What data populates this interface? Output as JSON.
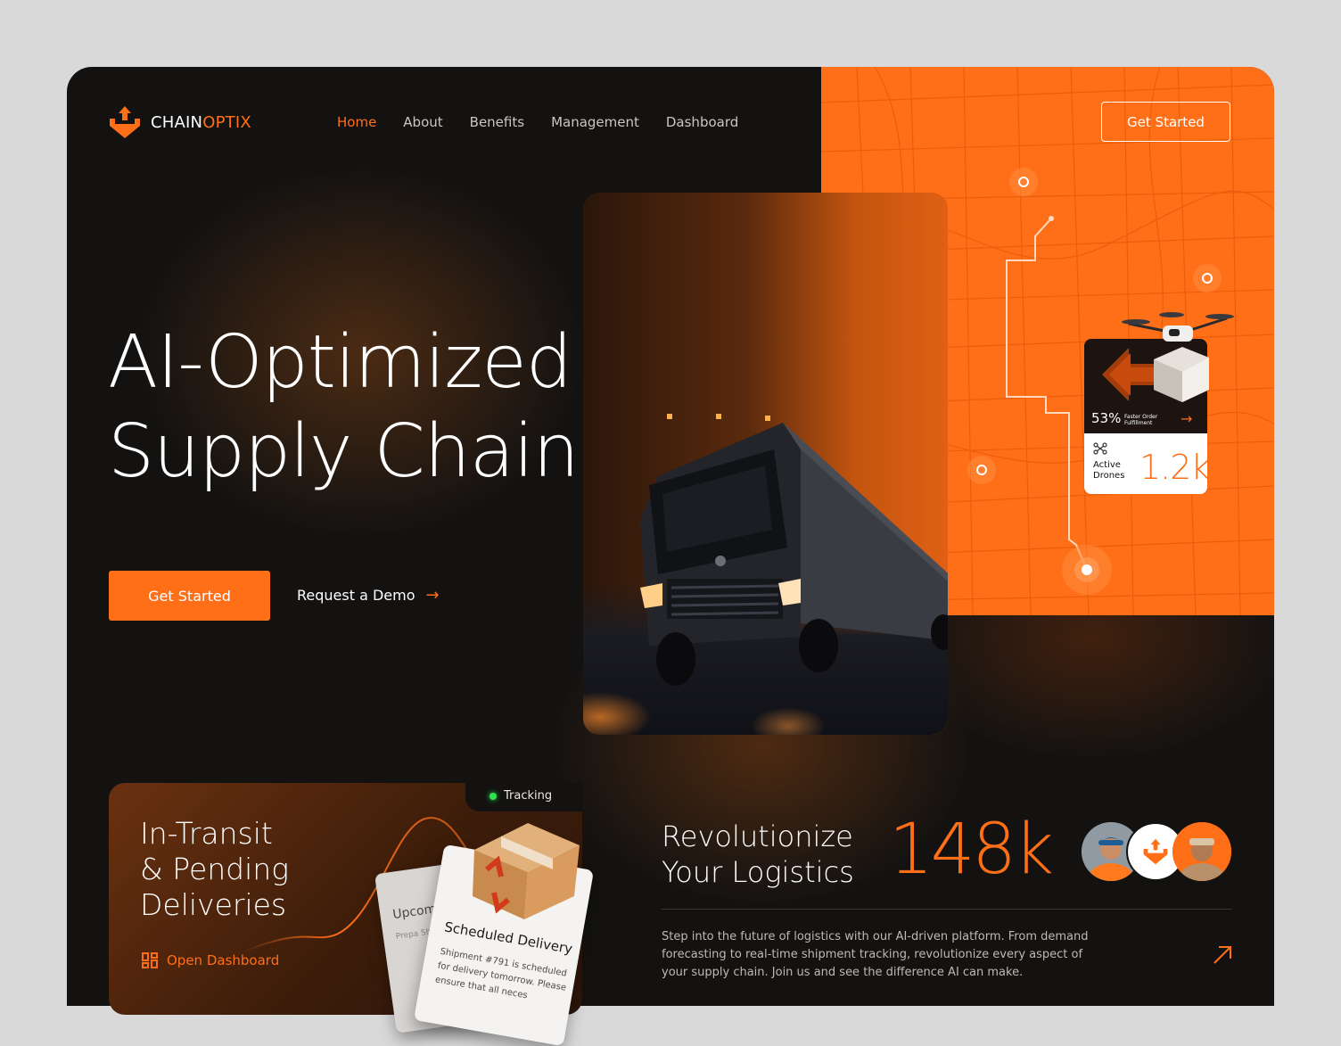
{
  "brand": {
    "name_main": "CHAIN",
    "name_accent": "OPTIX"
  },
  "nav": {
    "items": [
      {
        "label": "Home",
        "active": true
      },
      {
        "label": "About",
        "active": false
      },
      {
        "label": "Benefits",
        "active": false
      },
      {
        "label": "Management",
        "active": false
      },
      {
        "label": "Dashboard",
        "active": false
      }
    ],
    "cta_label": "Get Started"
  },
  "hero": {
    "title_line1": "AI-Optimized",
    "title_line2": "Supply Chain",
    "primary_label": "Get Started",
    "secondary_label": "Request a Demo",
    "secondary_icon": "arrow-right-icon"
  },
  "drone_card": {
    "percent": "53%",
    "percent_label": "Faster Order Fulfillment",
    "drones_label_line1": "Active",
    "drones_label_line2": "Drones",
    "drones_value": "1.2k"
  },
  "transit_card": {
    "status_label": "Tracking",
    "title_line1": "In-Transit",
    "title_line2": "& Pending",
    "title_line3": "Deliveries",
    "link_label": "Open Dashboard",
    "back_note": {
      "title": "Upcom",
      "body": "Prepa Shipm nece and a"
    },
    "front_note": {
      "title": "Scheduled Delivery",
      "body": "Shipment #791 is scheduled for delivery tomorrow. Please ensure that all neces"
    }
  },
  "revolution": {
    "title_line1": "Revolutionize",
    "title_line2": "Your Logistics",
    "stat": "148k",
    "description": "Step into the future of logistics with our AI-driven platform. From demand forecasting to real-time shipment tracking, revolutionize every aspect of your supply chain. Join us and see the difference AI can make."
  },
  "colors": {
    "accent": "#ff6f17",
    "background": "#131211",
    "status_green": "#2fe34b"
  }
}
